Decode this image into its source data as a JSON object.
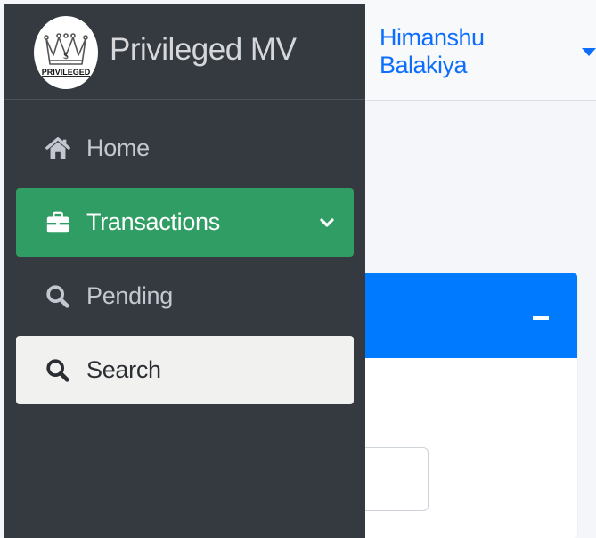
{
  "header": {
    "user_name": "Himanshu Balakiya"
  },
  "brand": {
    "name": "Privileged MV",
    "logo_text": "PRIVILEGED",
    "logo_symbol": "$"
  },
  "sidebar": {
    "items": [
      {
        "label": "Home",
        "icon": "home-icon"
      },
      {
        "label": "Transactions",
        "icon": "briefcase-icon",
        "active": true
      },
      {
        "label": "Pending",
        "icon": "search-icon"
      },
      {
        "label": "Search",
        "icon": "search-icon",
        "selected": true
      }
    ]
  },
  "colors": {
    "sidebar_bg": "#343a40",
    "active_green": "#2f9d64",
    "selected_bg": "#f1f1ef",
    "accent_blue": "#007bff",
    "link_blue": "#0d6efd"
  }
}
